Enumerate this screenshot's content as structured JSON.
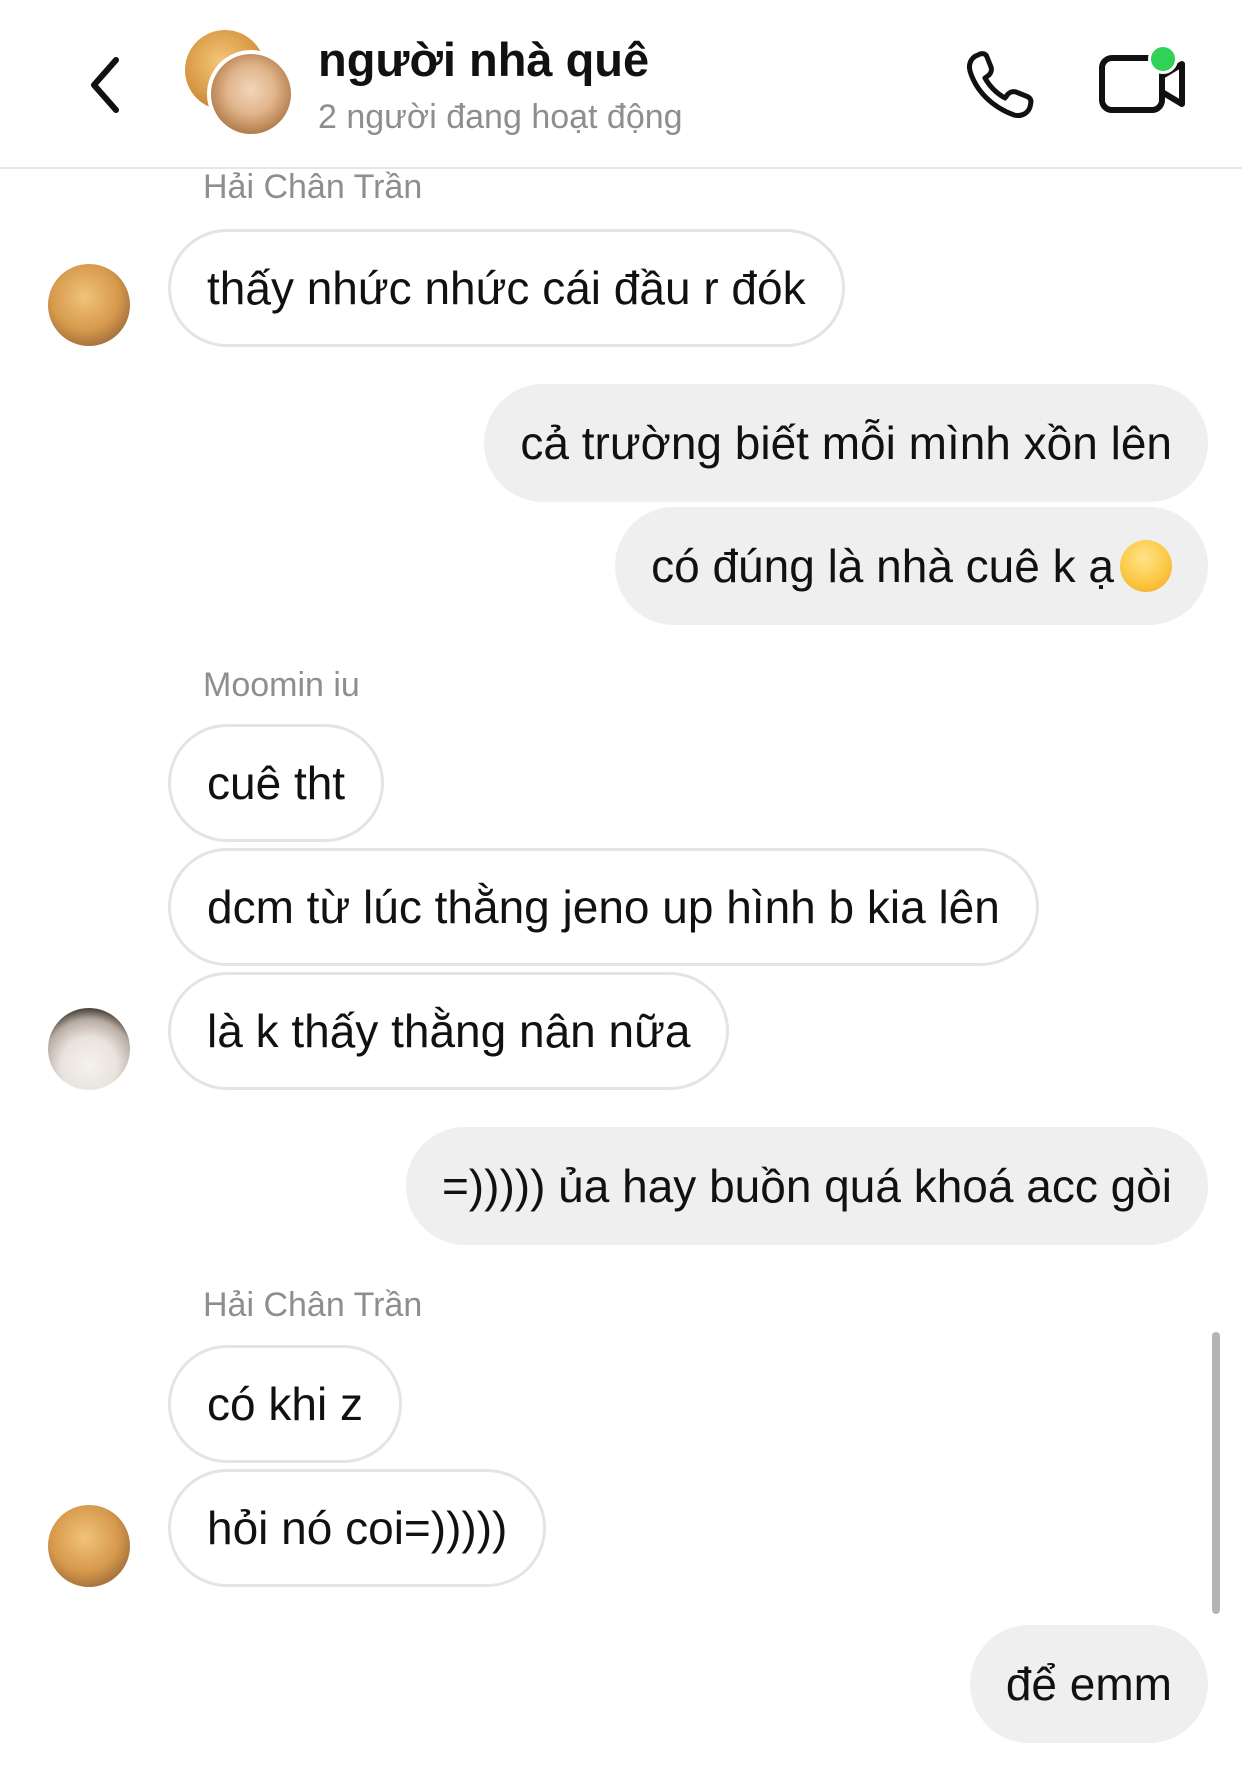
{
  "header": {
    "title": "người nhà quê",
    "status": "2 người đang hoạt động",
    "icons": {
      "back": "chevron-left-icon",
      "avatar": "group-avatar",
      "phone": "phone-icon",
      "video": "video-call-icon"
    },
    "online_color": "#31d158"
  },
  "messages": {
    "sender_1": "Hải Chân Trần",
    "m1": "thấy nhức nhức cái đầu r đók",
    "m2": "cả trường biết mỗi mình xồn lên",
    "m3": "có đúng là nhà cuê k ạ",
    "m3_emoji": "😊",
    "sender_2": "Moomin iu",
    "m4": "cuê tht",
    "m5": "dcm từ lúc thằng jeno up hình b kia lên",
    "m6": "là k thấy thằng nân nữa",
    "m7": "=))))) ủa hay buồn quá khoá acc gòi",
    "sender_3": "Hải Chân Trần",
    "m8": "có khi z",
    "m9": "hỏi nó coi=)))))",
    "m10": "để emm"
  },
  "colors": {
    "outgoing_bubble": "#efefef",
    "incoming_border": "#e4e4e4",
    "secondary_text": "#8e8e8e"
  }
}
